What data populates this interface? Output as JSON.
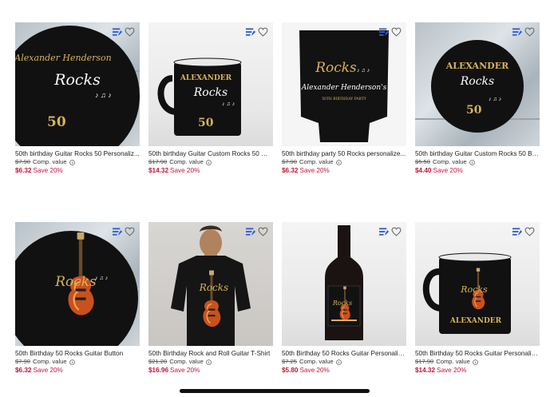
{
  "products": [
    {
      "title": "50th birthday Guitar Rocks 50 Personaliz...",
      "original": "$7.90",
      "comp": "Comp. value",
      "sale": "$6.32",
      "save": "Save 20%",
      "art_name": "Alexander Henderson",
      "art_word": "Rocks",
      "art_num": "50"
    },
    {
      "title": "50th birthday Guitar Custom Rocks 50 Mug",
      "original": "$17.90",
      "comp": "Comp. value",
      "sale": "$14.32",
      "save": "Save 20%",
      "art_name": "ALEXANDER",
      "art_word": "Rocks",
      "art_num": "50"
    },
    {
      "title": "50th birthday party 50 Rocks personalize...",
      "original": "$7.90",
      "comp": "Comp. value",
      "sale": "$6.32",
      "save": "Save 20%",
      "art_word": "Rocks",
      "art_name": "Alexander Henderson's",
      "art_sub": "50TH BIRTHDAY PARTY"
    },
    {
      "title": "50th birthday Guitar Custom Rocks 50 Bu...",
      "original": "$5.50",
      "comp": "Comp. value",
      "sale": "$4.40",
      "save": "Save 20%",
      "art_name": "ALEXANDER",
      "art_word": "Rocks",
      "art_num": "50"
    },
    {
      "title": "50th Birthday 50 Rocks Guitar Button",
      "original": "$7.90",
      "comp": "Comp. value",
      "sale": "$6.32",
      "save": "Save 20%",
      "art_word": "Rocks"
    },
    {
      "title": "50th Birthday Rock and Roll Guitar T-Shirt",
      "original": "$21.20",
      "comp": "Comp. value",
      "sale": "$16.96",
      "save": "Save 20%",
      "art_word": "Rocks"
    },
    {
      "title": "50th Birthday 50 Rocks Guitar Personaliz...",
      "original": "$7.25",
      "comp": "Comp. value",
      "sale": "$5.80",
      "save": "Save 20%",
      "art_word": "Rocks"
    },
    {
      "title": "50th Birthday 50 Rocks Guitar Personaliz...",
      "original": "$17.90",
      "comp": "Comp. value",
      "sale": "$14.32",
      "save": "Save 20%",
      "art_word": "Rocks",
      "art_name": "ALEXANDER"
    }
  ],
  "colors": {
    "sale": "#c4143a",
    "gold": "#d8b25a",
    "badge": "#2f5fd0"
  }
}
